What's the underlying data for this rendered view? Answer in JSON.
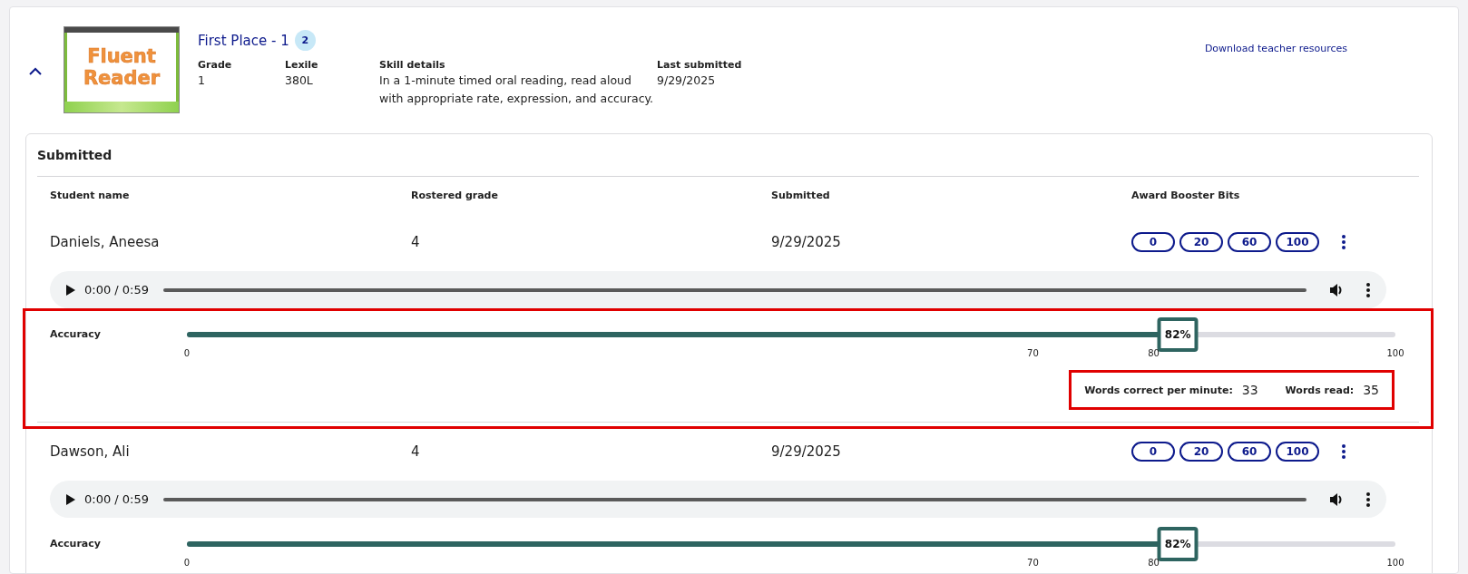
{
  "assignment": {
    "expanded": true,
    "thumbnail": {
      "lines": [
        "Fluent",
        "Reader"
      ]
    },
    "title": "First Place - 1",
    "badge": "2",
    "download_link": "Download teacher resources",
    "details": [
      {
        "label": "Grade",
        "value": "1"
      },
      {
        "label": "Lexile",
        "value": "380L"
      },
      {
        "label": "Skill details",
        "value": "In a 1-minute timed oral reading, read aloud with appropriate rate, expression, and accuracy."
      },
      {
        "label": "Last submitted",
        "value": "9/29/2025"
      }
    ]
  },
  "section_title": "Submitted",
  "columns": [
    "Student name",
    "Rostered grade",
    "Submitted",
    "Award Booster Bits"
  ],
  "students": [
    {
      "name": "Daniels, Aneesa",
      "grade": "4",
      "submitted": "9/29/2025",
      "awards": [
        "0",
        "20",
        "60",
        "100"
      ],
      "audio_time": "0:00 / 0:59",
      "accuracy_label": "Accuracy",
      "level": 0.82,
      "reading": "82%",
      "ticks": [
        "0",
        "70",
        "80",
        "100"
      ],
      "highlighted": true,
      "stats": {
        "highlighted": true,
        "items": [
          {
            "label": "Words correct per minute:",
            "value": "33"
          },
          {
            "label": "Words read:",
            "value": "35"
          }
        ]
      }
    },
    {
      "name": "Dawson, Ali",
      "grade": "4",
      "submitted": "9/29/2025",
      "awards": [
        "0",
        "20",
        "60",
        "100"
      ],
      "audio_time": "0:00 / 0:59",
      "accuracy_label": "Accuracy",
      "level": 0.82,
      "reading": "82%",
      "ticks": [
        "0",
        "70",
        "80",
        "100"
      ],
      "highlighted": false
    }
  ]
}
